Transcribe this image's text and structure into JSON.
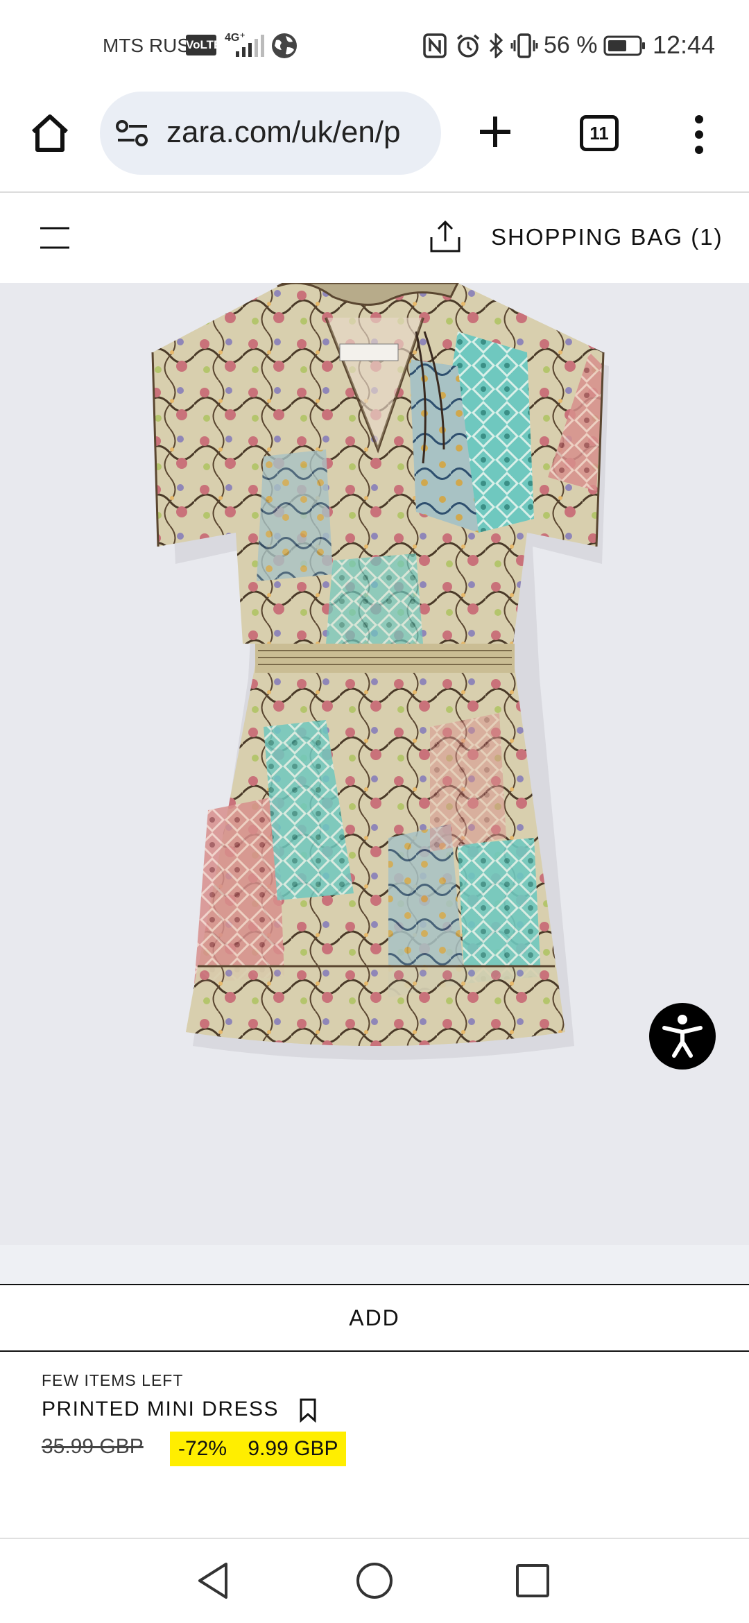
{
  "status_bar": {
    "carrier": "MTS RUS",
    "volte": "VoLTE",
    "network": "4G⁺",
    "battery_percent": "56 %",
    "time": "12:44",
    "icons": [
      "signal-icon",
      "globe-icon",
      "nfc-icon",
      "alarm-icon",
      "bluetooth-icon",
      "vibrate-icon",
      "battery-icon"
    ]
  },
  "browser": {
    "url": "zara.com/uk/en/p",
    "tab_count": "11",
    "icons": [
      "home-icon",
      "site-settings-icon",
      "plus-icon",
      "more-vert-icon"
    ]
  },
  "site_header": {
    "bag_label": "SHOPPING BAG (1)",
    "icons": [
      "menu-icon",
      "share-icon"
    ]
  },
  "product": {
    "image_alt": "printed-mini-dress-photo",
    "add_label": "ADD",
    "stock_notice": "FEW ITEMS LEFT",
    "name": "PRINTED MINI DRESS",
    "old_price": "35.99 GBP",
    "discount": "-72%",
    "new_price": "9.99 GBP",
    "sale_highlight_color": "#ffee00"
  },
  "accessibility_button": {
    "icon": "accessibility-icon",
    "color": "#000000"
  },
  "nav_bar": {
    "icons": [
      "back-icon",
      "home-circle-icon",
      "recent-apps-icon"
    ]
  }
}
